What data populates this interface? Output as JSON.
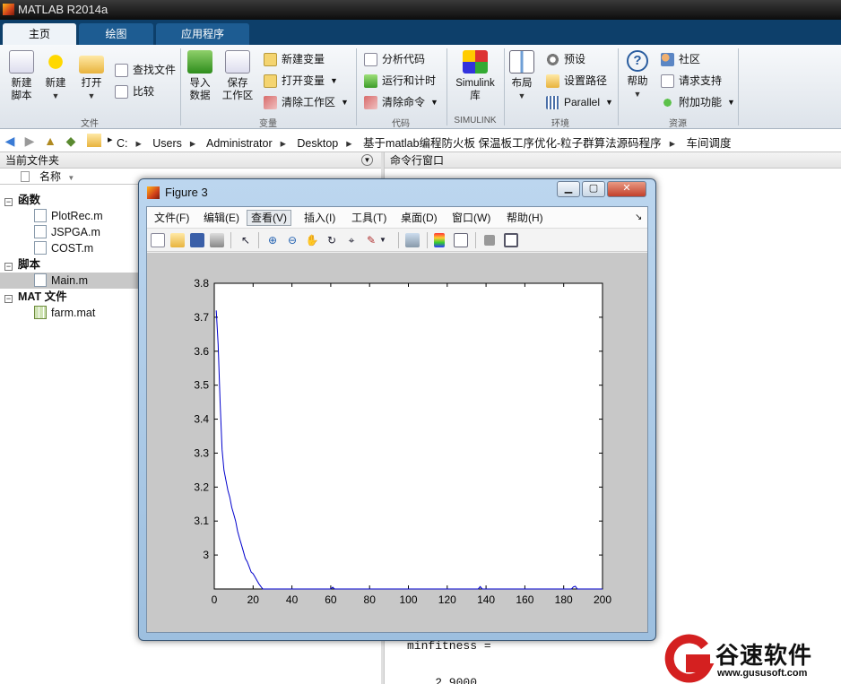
{
  "window": {
    "title": "MATLAB R2014a"
  },
  "tabs": [
    {
      "label": "主页",
      "active": true
    },
    {
      "label": "绘图",
      "active": false
    },
    {
      "label": "应用程序",
      "active": false
    }
  ],
  "ribbon": {
    "file": {
      "new_script": "新建\n脚本",
      "new": "新建",
      "open": "打开",
      "find_files": "查找文件",
      "compare": "比较",
      "group": "文件"
    },
    "variable": {
      "import_data": "导入\n数据",
      "save_workspace": "保存\n工作区",
      "new_variable": "新建变量",
      "open_variable": "打开变量",
      "clear_workspace": "清除工作区",
      "group": "变量"
    },
    "code": {
      "analyze_code": "分析代码",
      "run_and_time": "运行和计时",
      "clear_commands": "清除命令",
      "group": "代码"
    },
    "simulink": {
      "library": "Simulink\n库",
      "group": "SIMULINK"
    },
    "environment": {
      "layout": "布局",
      "preferences": "预设",
      "set_path": "设置路径",
      "parallel": "Parallel",
      "group": "环境"
    },
    "resources": {
      "help": "帮助",
      "community": "社区",
      "request_support": "请求支持",
      "add_ons": "附加功能",
      "group": "资源"
    }
  },
  "address": {
    "crumbs": [
      "C:",
      "Users",
      "Administrator",
      "Desktop",
      "基于matlab编程防火板 保温板工序优化-粒子群算法源码程序",
      "车间调度"
    ]
  },
  "current_folder": {
    "title": "当前文件夹",
    "name_col": "名称",
    "sections": [
      {
        "label": "函数",
        "files": [
          "PlotRec.m",
          "JSPGA.m",
          "COST.m"
        ]
      },
      {
        "label": "脚本",
        "files": [
          "Main.m"
        ]
      },
      {
        "label": "MAT 文件",
        "files": [
          "farm.mat"
        ]
      }
    ]
  },
  "command_window": {
    "title": "命令行窗口",
    "lines": [
      "minfitness =",
      "    2.9000"
    ]
  },
  "figure": {
    "title": "Figure 3",
    "menus": [
      "文件(F)",
      "编辑(E)",
      "查看(V)",
      "插入(I)",
      "工具(T)",
      "桌面(D)",
      "窗口(W)",
      "帮助(H)"
    ],
    "selected_menu": "查看(V)"
  },
  "chart_data": {
    "type": "line",
    "title": "",
    "xlabel": "",
    "ylabel": "",
    "xlim": [
      0,
      200
    ],
    "ylim": [
      2.9,
      3.8
    ],
    "xticks": [
      0,
      20,
      40,
      60,
      80,
      100,
      120,
      140,
      160,
      180,
      200
    ],
    "yticks": [
      3,
      3.1,
      3.2,
      3.3,
      3.4,
      3.5,
      3.6,
      3.7,
      3.8
    ],
    "grid": false,
    "line_color": "#0000cc",
    "series": [
      {
        "x": [
          1,
          2,
          3,
          4,
          5,
          6,
          7,
          8,
          9,
          10,
          11,
          12,
          13,
          14,
          15,
          16,
          17,
          18,
          19,
          20,
          21,
          22,
          23,
          24,
          25,
          26,
          30,
          40,
          50,
          60,
          61,
          62,
          63,
          64,
          80,
          100,
          120,
          136,
          137,
          138,
          139,
          140,
          160,
          184,
          185,
          186,
          187,
          188,
          200
        ],
        "y": [
          3.72,
          3.62,
          3.45,
          3.31,
          3.25,
          3.22,
          3.19,
          3.17,
          3.14,
          3.12,
          3.1,
          3.07,
          3.05,
          3.03,
          3.01,
          2.99,
          2.98,
          2.965,
          2.95,
          2.945,
          2.935,
          2.925,
          2.915,
          2.907,
          2.9,
          2.9,
          2.9,
          2.9,
          2.9,
          2.9,
          2.905,
          2.9,
          2.9,
          2.9,
          2.9,
          2.9,
          2.9,
          2.9,
          2.907,
          2.9,
          2.9,
          2.9,
          2.9,
          2.9,
          2.906,
          2.908,
          2.9,
          2.9,
          2.9
        ]
      }
    ]
  },
  "colors": {
    "accent": "#0d3f6a",
    "tab": "#1d5c92",
    "figure_bg": "#c8c8c8"
  },
  "watermark": {
    "brand": "谷速软件",
    "url": "www.gususoft.com"
  }
}
